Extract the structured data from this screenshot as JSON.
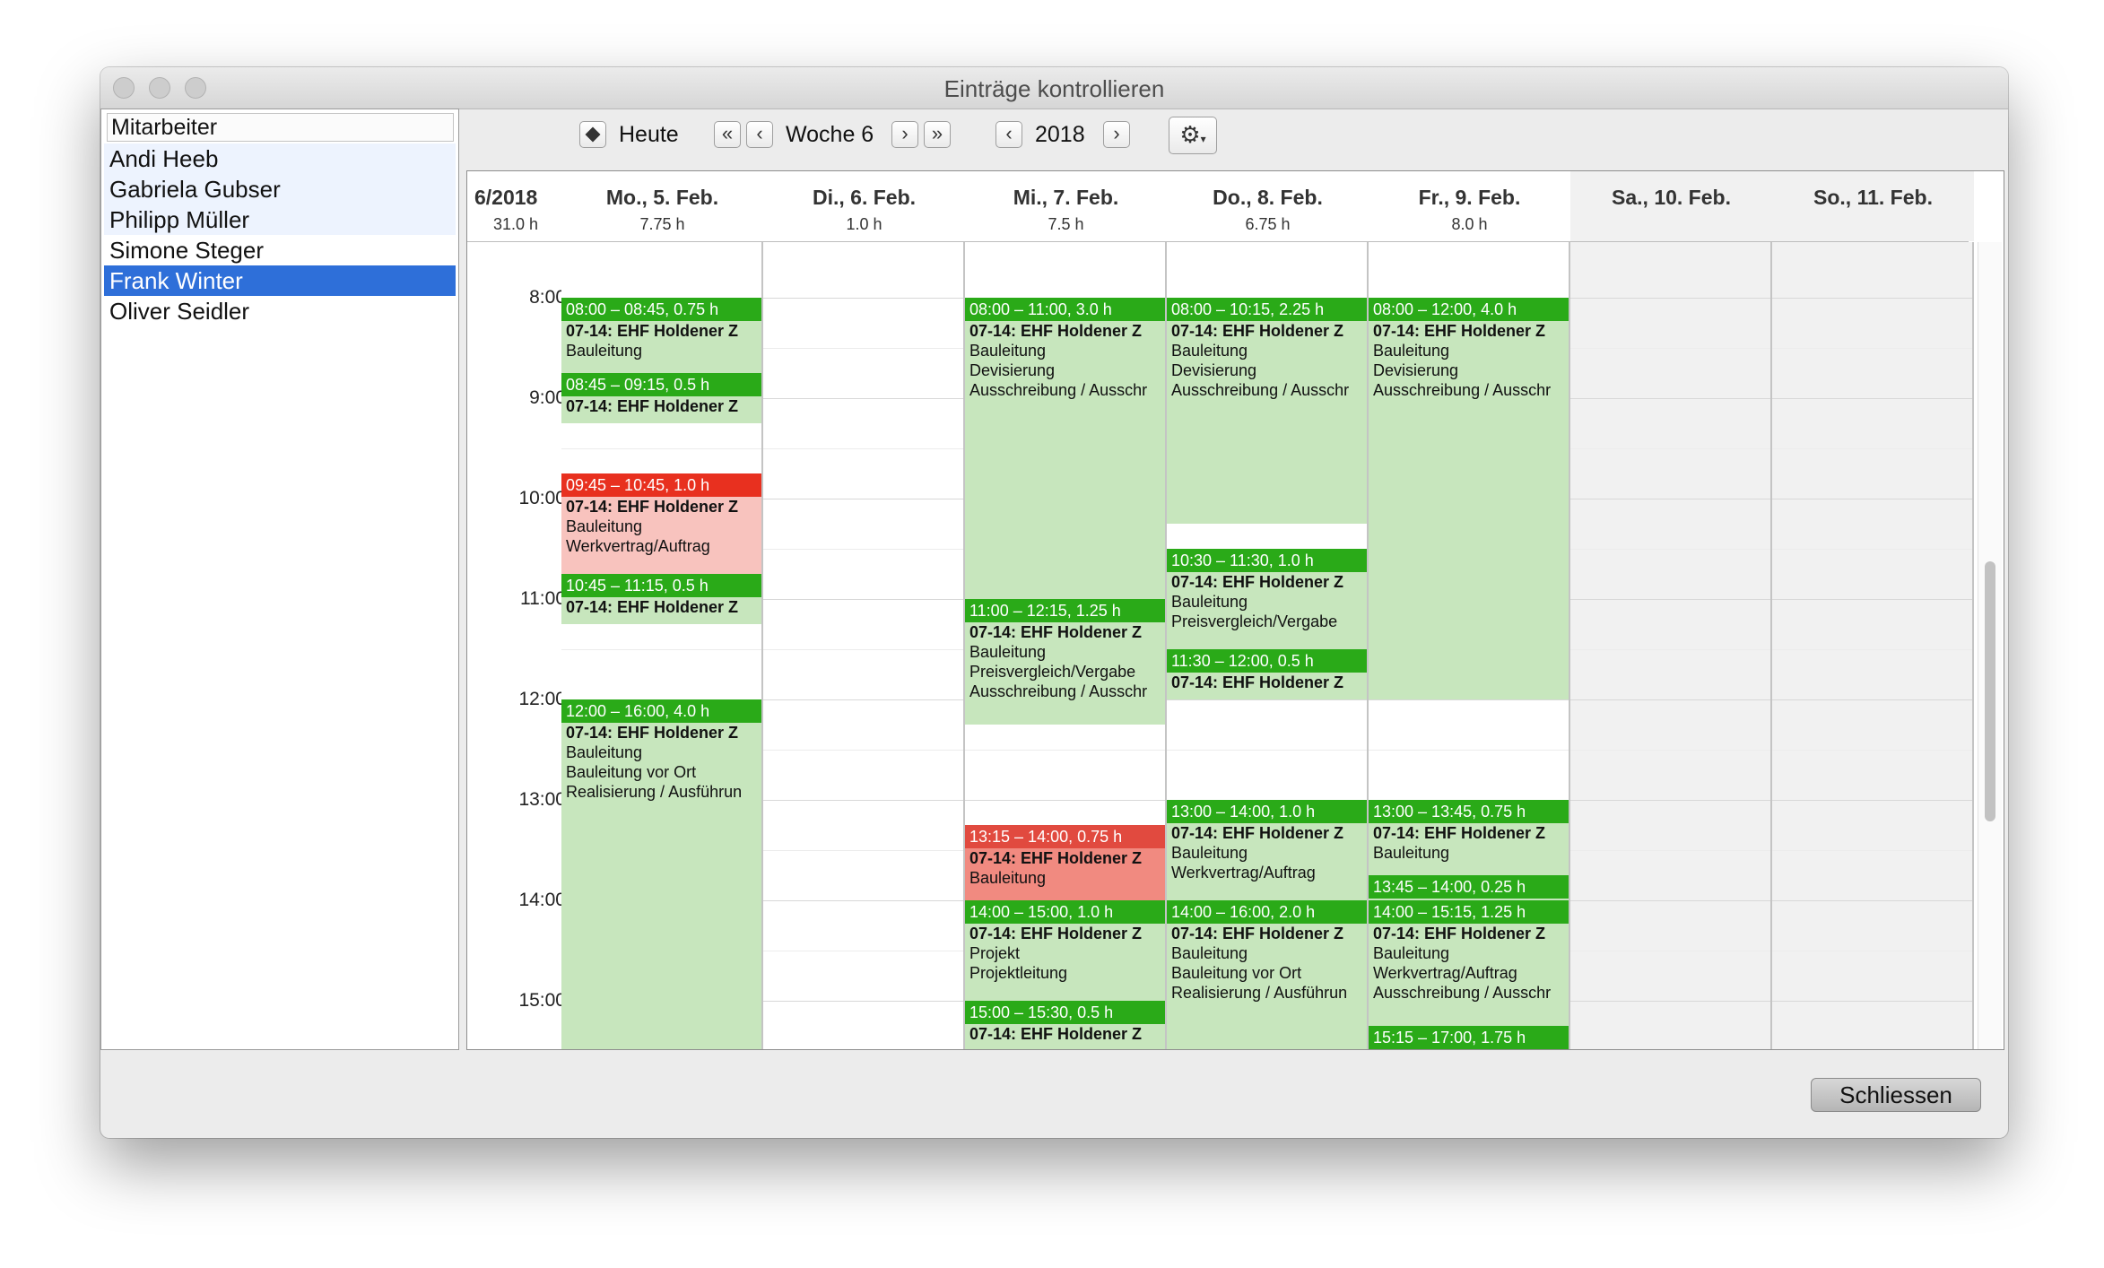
{
  "window": {
    "title": "Einträge kontrollieren"
  },
  "employees": {
    "header": "Mitarbeiter",
    "items": [
      {
        "name": "Andi Heeb"
      },
      {
        "name": "Gabriela Gubser"
      },
      {
        "name": "Philipp Müller"
      },
      {
        "name": "Simone Steger"
      },
      {
        "name": "Frank Winter",
        "selected": true
      },
      {
        "name": "Oliver Seidler"
      }
    ]
  },
  "toolbar": {
    "today_label": "Heute",
    "week_label": "Woche 6",
    "year_label": "2018",
    "icons": [
      "diamond-icon",
      "double-chevron-left-icon",
      "chevron-left-icon",
      "chevron-right-icon",
      "double-chevron-right-icon",
      "gear-icon"
    ]
  },
  "calendar": {
    "week_summary": {
      "label": "6/2018",
      "hours": "31.0 h"
    },
    "days": [
      {
        "label": "Mo., 5. Feb.",
        "hours": "7.75 h"
      },
      {
        "label": "Di., 6. Feb.",
        "hours": "1.0 h"
      },
      {
        "label": "Mi., 7. Feb.",
        "hours": "7.5 h"
      },
      {
        "label": "Do., 8. Feb.",
        "hours": "6.75 h"
      },
      {
        "label": "Fr., 9. Feb.",
        "hours": "8.0 h"
      },
      {
        "label": "Sa., 10. Feb.",
        "hours": "",
        "weekend": true
      },
      {
        "label": "So., 11. Feb.",
        "hours": "",
        "weekend": true
      }
    ],
    "time_labels": [
      "8:00",
      "9:00",
      "10:00",
      "11:00",
      "12:00",
      "13:00",
      "14:00",
      "15:00"
    ],
    "events": [
      {
        "day": 0,
        "start": 8.0,
        "end": 8.75,
        "status": "ok",
        "header": "08:00 – 08:45, 0.75 h",
        "lines": [
          "07-14: EHF Holdener Z",
          "Bauleitung"
        ]
      },
      {
        "day": 0,
        "start": 8.75,
        "end": 9.25,
        "status": "ok",
        "header": "08:45 – 09:15, 0.5 h",
        "lines": [
          "07-14: EHF Holdener Z"
        ]
      },
      {
        "day": 0,
        "start": 9.75,
        "end": 10.75,
        "status": "warn",
        "header": "09:45 – 10:45, 1.0 h",
        "lines": [
          "07-14: EHF Holdener Z",
          "Bauleitung",
          "Werkvertrag/Auftrag"
        ]
      },
      {
        "day": 0,
        "start": 10.75,
        "end": 11.25,
        "status": "ok",
        "header": "10:45 – 11:15, 0.5 h",
        "lines": [
          "07-14: EHF Holdener Z"
        ]
      },
      {
        "day": 0,
        "start": 12.0,
        "end": 16.0,
        "status": "ok",
        "header": "12:00 – 16:00, 4.0 h",
        "lines": [
          "07-14: EHF Holdener Z",
          "Bauleitung",
          "Bauleitung vor Ort",
          "Realisierung / Ausführun"
        ]
      },
      {
        "day": 2,
        "start": 8.0,
        "end": 11.0,
        "status": "ok",
        "header": "08:00 – 11:00, 3.0 h",
        "lines": [
          "07-14: EHF Holdener Z",
          "Bauleitung",
          "Devisierung",
          "Ausschreibung / Ausschr"
        ]
      },
      {
        "day": 2,
        "start": 11.0,
        "end": 12.25,
        "status": "ok",
        "header": "11:00 – 12:15, 1.25 h",
        "lines": [
          "07-14: EHF Holdener Z",
          "Bauleitung",
          "Preisvergleich/Vergabe",
          "Ausschreibung / Ausschr"
        ]
      },
      {
        "day": 2,
        "start": 13.25,
        "end": 14.0,
        "status": "warn2",
        "header": "13:15 – 14:00, 0.75 h",
        "lines": [
          "07-14: EHF Holdener Z",
          "Bauleitung"
        ]
      },
      {
        "day": 2,
        "start": 14.0,
        "end": 15.0,
        "status": "ok",
        "header": "14:00 – 15:00, 1.0 h",
        "lines": [
          "07-14: EHF Holdener Z",
          "Projekt",
          "Projektleitung"
        ]
      },
      {
        "day": 2,
        "start": 15.0,
        "end": 15.5,
        "status": "ok",
        "header": "15:00 – 15:30, 0.5 h",
        "lines": [
          "07-14: EHF Holdener Z"
        ]
      },
      {
        "day": 3,
        "start": 8.0,
        "end": 10.25,
        "status": "ok",
        "header": "08:00 – 10:15, 2.25 h",
        "lines": [
          "07-14: EHF Holdener Z",
          "Bauleitung",
          "Devisierung",
          "Ausschreibung / Ausschr"
        ]
      },
      {
        "day": 3,
        "start": 10.5,
        "end": 11.5,
        "status": "ok",
        "header": "10:30 – 11:30, 1.0 h",
        "lines": [
          "07-14: EHF Holdener Z",
          "Bauleitung",
          "Preisvergleich/Vergabe"
        ]
      },
      {
        "day": 3,
        "start": 11.5,
        "end": 12.0,
        "status": "ok",
        "header": "11:30 – 12:00, 0.5 h",
        "lines": [
          "07-14: EHF Holdener Z"
        ]
      },
      {
        "day": 3,
        "start": 13.0,
        "end": 14.0,
        "status": "ok",
        "header": "13:00 – 14:00, 1.0 h",
        "lines": [
          "07-14: EHF Holdener Z",
          "Bauleitung",
          "Werkvertrag/Auftrag"
        ]
      },
      {
        "day": 3,
        "start": 14.0,
        "end": 16.0,
        "status": "ok",
        "header": "14:00 – 16:00, 2.0 h",
        "lines": [
          "07-14: EHF Holdener Z",
          "Bauleitung",
          "Bauleitung vor Ort",
          "Realisierung / Ausführun"
        ]
      },
      {
        "day": 4,
        "start": 8.0,
        "end": 12.0,
        "status": "ok",
        "header": "08:00 – 12:00, 4.0 h",
        "lines": [
          "07-14: EHF Holdener Z",
          "Bauleitung",
          "Devisierung",
          "Ausschreibung / Ausschr"
        ]
      },
      {
        "day": 4,
        "start": 13.0,
        "end": 13.75,
        "status": "ok",
        "header": "13:00 – 13:45, 0.75 h",
        "lines": [
          "07-14: EHF Holdener Z",
          "Bauleitung"
        ]
      },
      {
        "day": 4,
        "start": 13.75,
        "end": 14.0,
        "status": "ok",
        "header": "13:45 – 14:00, 0.25 h",
        "lines": []
      },
      {
        "day": 4,
        "start": 14.0,
        "end": 15.25,
        "status": "ok",
        "header": "14:00 – 15:15, 1.25 h",
        "lines": [
          "07-14: EHF Holdener Z",
          "Bauleitung",
          "Werkvertrag/Auftrag",
          "Ausschreibung / Ausschr"
        ]
      },
      {
        "day": 4,
        "start": 15.25,
        "end": 17.0,
        "status": "ok",
        "header": "15:15 – 17:00, 1.75 h",
        "lines": []
      }
    ]
  },
  "footer": {
    "close_label": "Schliessen"
  },
  "colors": {
    "selection": "#2e6fd9",
    "event_ok": "#2aaa18",
    "event_ok_bg": "#c7e6bd",
    "event_warn": "#e8301f",
    "event_warn_bg": "#f8c3be"
  }
}
